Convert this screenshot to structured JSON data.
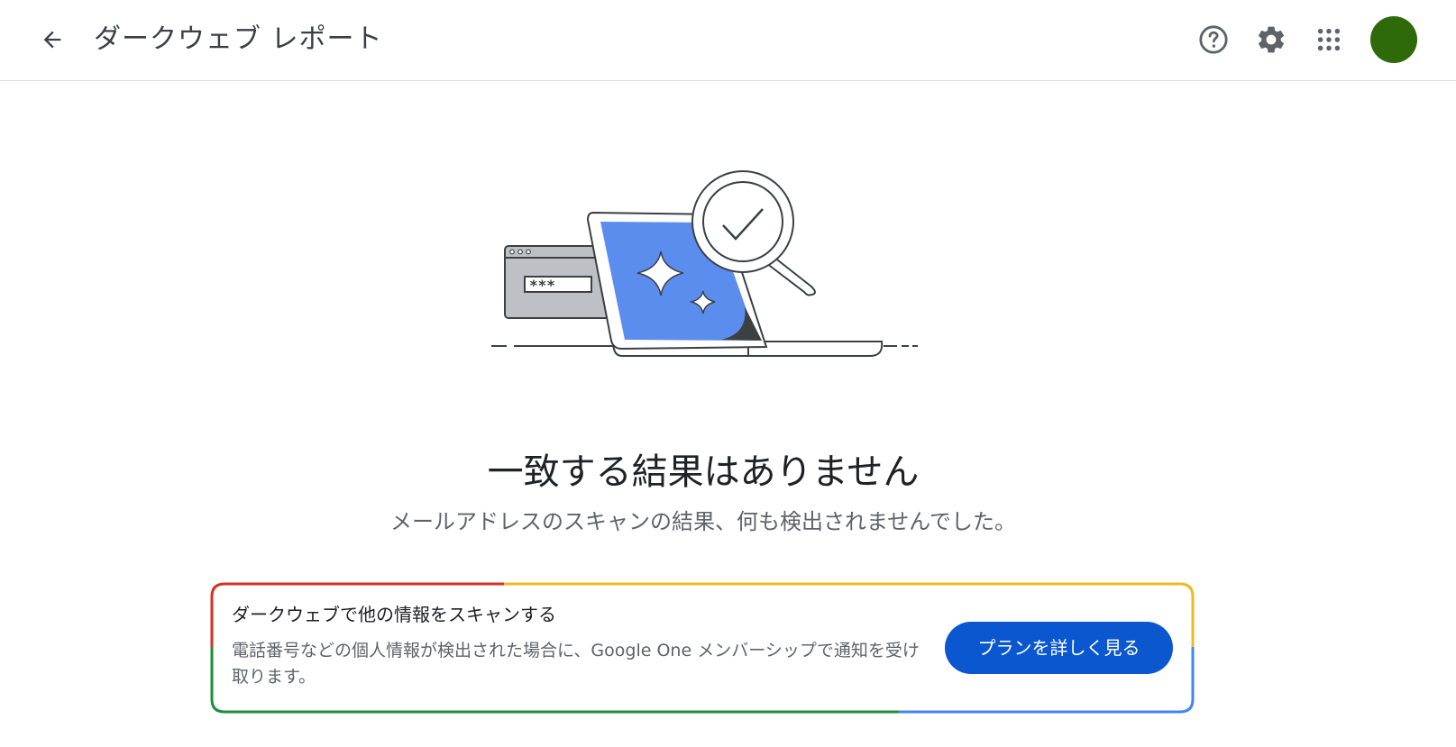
{
  "header": {
    "title": "ダークウェブ レポート",
    "back_icon": "arrow-back-icon",
    "help_icon": "help-circle-icon",
    "settings_icon": "gear-icon",
    "apps_icon": "apps-grid-icon",
    "avatar_color": "#2f6a0a"
  },
  "illustration": {
    "password_text": "***"
  },
  "result": {
    "title": "一致する結果はありません",
    "subtitle": "メールアドレスのスキャンの結果、何も検出されませんでした。"
  },
  "promo": {
    "title": "ダークウェブで他の情報をスキャンする",
    "body": "電話番号などの個人情報が検出された場合に、Google One メンバーシップで通知を受け取ります。",
    "button_label": "プランを詳しく見る",
    "border_colors": [
      "#d93025",
      "#f2b824",
      "#1e8e3e",
      "#4285f4"
    ],
    "button_color": "#0b57d0"
  }
}
